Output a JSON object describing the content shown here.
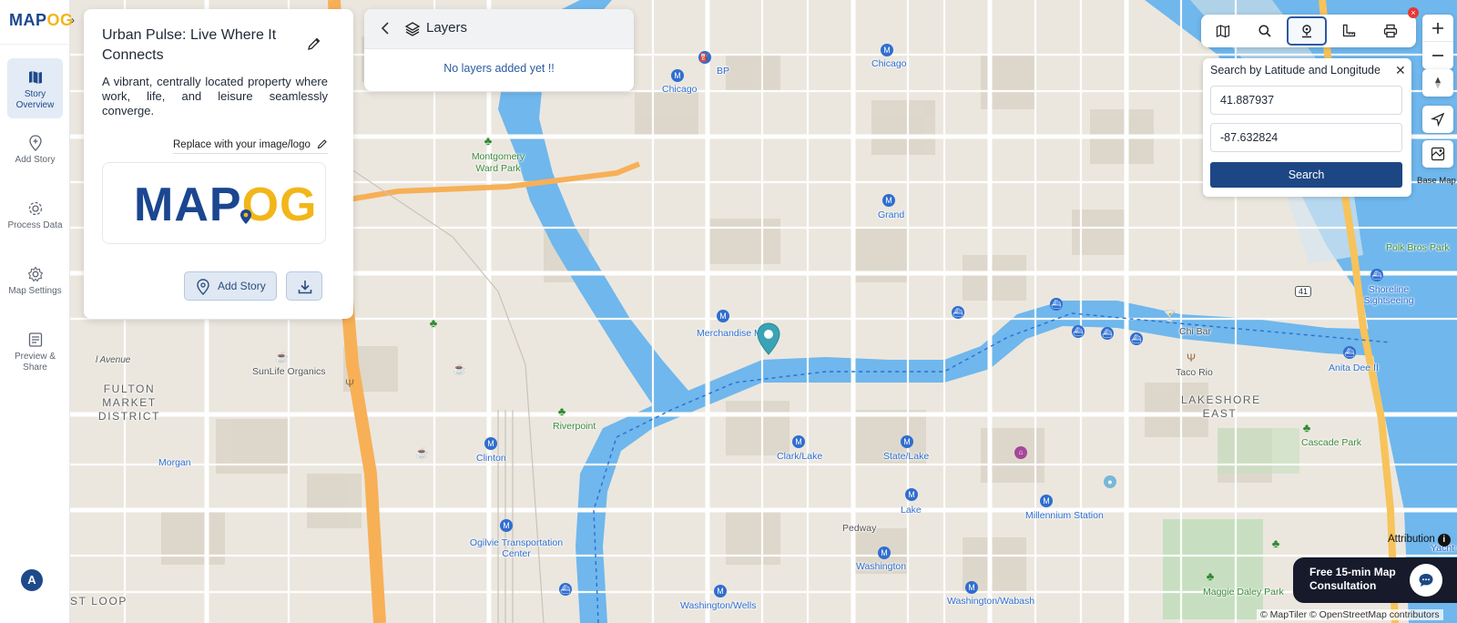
{
  "app": {
    "logo_main": "MAP",
    "logo_accent": "OG",
    "collapse_icon": "chevron-right-icon"
  },
  "sidebar": {
    "items": [
      {
        "label": "Story Overview",
        "icon": "map-book-icon",
        "active": true
      },
      {
        "label": "Add Story",
        "icon": "map-pin-icon",
        "active": false
      },
      {
        "label": "Process Data",
        "icon": "gear-icon",
        "active": false
      },
      {
        "label": "Map Settings",
        "icon": "settings-icon",
        "active": false
      },
      {
        "label": "Preview & Share",
        "icon": "preview-icon",
        "active": false
      }
    ],
    "avatar_initial": "A"
  },
  "story": {
    "title": "Urban Pulse: Live Where It Connects",
    "description": "A vibrant, centrally located property where work, life, and leisure seamlessly converge.",
    "replace_label": "Replace with your image/logo",
    "logo_main": "MAP",
    "logo_accent": "OG",
    "add_story_label": "Add Story"
  },
  "layers": {
    "title": "Layers",
    "empty_message": "No layers added yet !!"
  },
  "toolbar": {
    "tools": [
      "map-icon",
      "search-icon",
      "location-pin-icon",
      "measure-icon",
      "print-icon"
    ],
    "active_tool": "location-pin-icon"
  },
  "latlng": {
    "title": "Search by Latitude and Longitude",
    "latitude": "41.887937",
    "longitude": "-87.632824",
    "search_label": "Search"
  },
  "map_controls": {
    "basemap_label": "Base Map"
  },
  "map": {
    "labels": {
      "chicago_1": "Chicago",
      "chicago_2": "Chicago",
      "bp": "BP",
      "montgomery": "Montgomery Ward Park",
      "grand": "Grand",
      "merchandise": "Merchandise M",
      "fulton": "FULTON MARKET DISTRICT",
      "avenue": "l Avenue",
      "sunlife": "SunLife Organics",
      "riverpoint": "Riverpoint",
      "morgan": "Morgan",
      "clinton": "Clinton",
      "clarklake": "Clark/Lake",
      "statelake": "State/Lake",
      "lake": "Lake",
      "millennium": "Millennium Station",
      "pedway": "Pedway",
      "washington": "Washington",
      "ogilvie": "Ogilvie Transportation Center",
      "washwells": "Washington/Wells",
      "washwabash": "Washington/Wabash",
      "loop": "ST LOOP",
      "polkbros": "Polk Bros Park",
      "shoreline": "Shoreline Sightseeing",
      "chibar": "Chi Bar",
      "tacorio": "Taco Rio",
      "anitadee": "Anita Dee II",
      "lakeshore": "LAKESHORE EAST",
      "cascade": "Cascade Park",
      "maggie": "Maggie Daley Park",
      "yacht": "Yacht C",
      "route41": "41"
    }
  },
  "footer": {
    "attribution_label": "Attribution",
    "consult_text": "Free 15-min Map Consultation",
    "copyright": "© MapTiler © OpenStreetMap contributors"
  }
}
